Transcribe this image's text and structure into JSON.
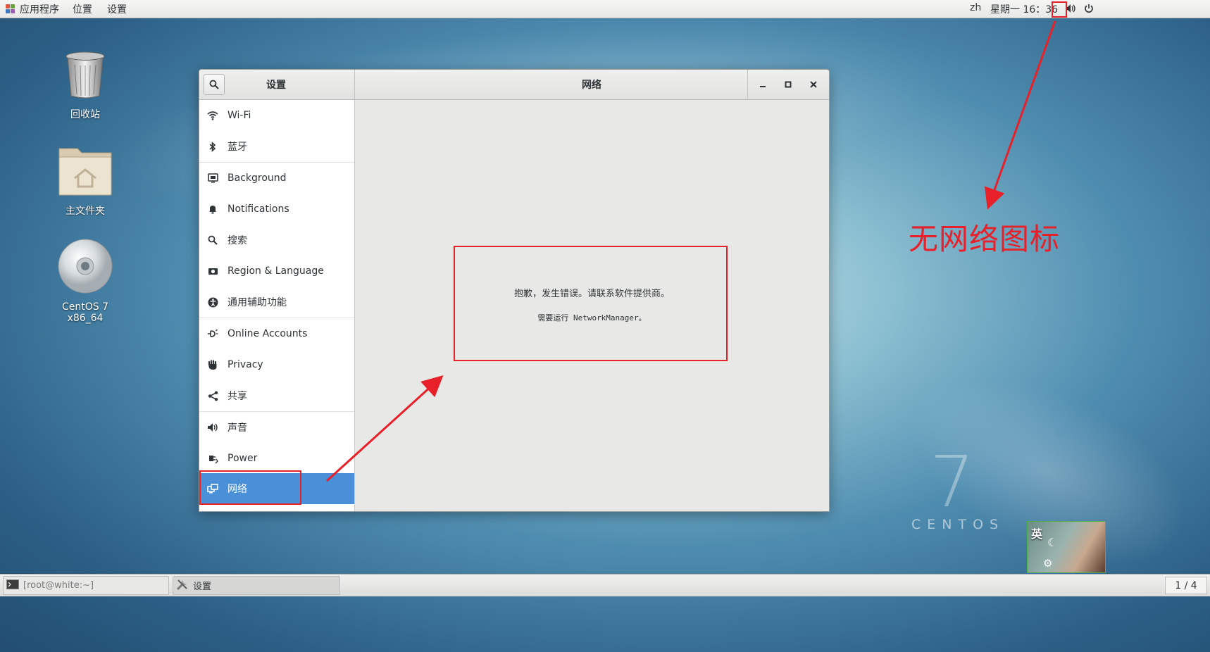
{
  "topbar": {
    "apps_label": "应用程序",
    "places_label": "位置",
    "settings_label": "设置",
    "lang": "zh",
    "datetime": "星期一 16：36"
  },
  "desktop": {
    "trash_label": "回收站",
    "home_label": "主文件夹",
    "disc_label": "CentOS 7 x86_64"
  },
  "window": {
    "sidebar_title": "设置",
    "main_title": "网络",
    "minimize": "–",
    "maximize": "□",
    "close": "✕"
  },
  "sidebar": {
    "items": [
      {
        "label": "Wi-Fi",
        "icon": "wifi-icon"
      },
      {
        "label": "蓝牙",
        "icon": "bluetooth-icon"
      },
      {
        "label": "Background",
        "icon": "background-icon"
      },
      {
        "label": "Notifications",
        "icon": "bell-icon"
      },
      {
        "label": "搜索",
        "icon": "search-icon"
      },
      {
        "label": "Region & Language",
        "icon": "region-icon"
      },
      {
        "label": "通用辅助功能",
        "icon": "accessibility-icon"
      },
      {
        "label": "Online Accounts",
        "icon": "online-accounts-icon"
      },
      {
        "label": "Privacy",
        "icon": "hand-icon"
      },
      {
        "label": "共享",
        "icon": "share-icon"
      },
      {
        "label": "声音",
        "icon": "speaker-icon"
      },
      {
        "label": "Power",
        "icon": "power-plug-icon"
      },
      {
        "label": "网络",
        "icon": "network-icon"
      }
    ],
    "selected": "网络"
  },
  "content": {
    "error_line1": "抱歉，发生错误。请联系软件提供商。",
    "error_line2": "需要运行 NetworkManager。"
  },
  "annotation": {
    "text": "无网络图标",
    "color": "#e8202a"
  },
  "watermark": {
    "number": "7",
    "text": "CENTOS"
  },
  "ime": {
    "label": "英"
  },
  "taskbar": {
    "terminal_task": "[root@white:~]",
    "settings_task": "设置",
    "workspace": "1 / 4"
  },
  "colors": {
    "selected": "#4a90d9",
    "annotation": "#e8202a"
  }
}
